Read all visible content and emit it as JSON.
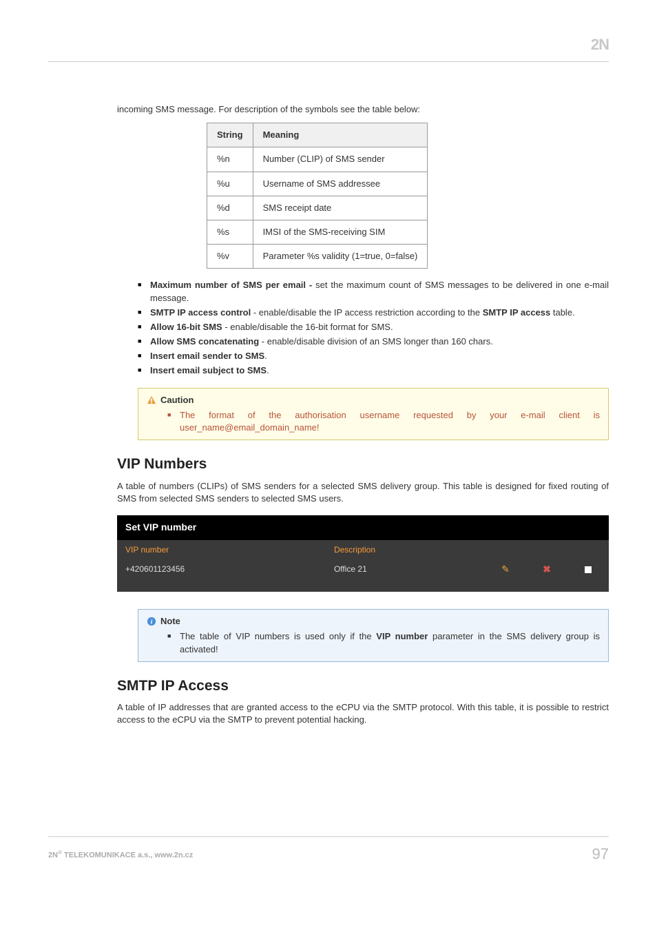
{
  "logo": "2N",
  "intro": "incoming SMS message. For description of the symbols see the table below:",
  "strings_header": {
    "col1": "String",
    "col2": "Meaning"
  },
  "strings": [
    {
      "s": "%n",
      "m": "Number (CLIP) of SMS sender"
    },
    {
      "s": "%u",
      "m": "Username of SMS addressee"
    },
    {
      "s": "%d",
      "m": "SMS receipt date"
    },
    {
      "s": "%s",
      "m": "IMSI of the SMS-receiving SIM"
    },
    {
      "s": "%v",
      "m": "Parameter %s validity (1=true, 0=false)"
    }
  ],
  "bullets": [
    {
      "b": "Maximum number of SMS per email - ",
      "t": "set the maximum count of SMS messages to be delivered in one e-mail message."
    },
    {
      "b": "SMTP IP access control",
      "t": " - enable/disable the IP access restriction according to the ",
      "b2": "SMTP IP access",
      "t2": " table."
    },
    {
      "b": "Allow 16-bit SMS",
      "t": " - enable/disable the 16-bit format for SMS."
    },
    {
      "b": "Allow SMS concatenating",
      "t": " - enable/disable division of an SMS longer than 160 chars."
    },
    {
      "b": "Insert email sender to SMS",
      "t": "."
    },
    {
      "b": "Insert email subject to SMS",
      "t": "."
    }
  ],
  "caution": {
    "title": "Caution",
    "text": "The format of the authorisation username requested by your e-mail client is user_name@email_domain_name!"
  },
  "vip": {
    "heading": "VIP Numbers",
    "para": "A table of numbers (CLIPs) of SMS senders for a selected SMS delivery group. This table is designed for fixed routing of SMS from selected SMS senders to selected SMS users.",
    "table_title": "Set VIP number",
    "col1": "VIP number",
    "col2": "Description",
    "row_num": "+420601123456",
    "row_desc": "Office 21"
  },
  "note": {
    "title": "Note",
    "text_pre": "The table of VIP numbers is used only if the ",
    "text_bold": "VIP number",
    "text_post": " parameter in the SMS delivery group is activated!"
  },
  "smtp": {
    "heading": "SMTP IP Access",
    "para": "A table of IP addresses that are granted access to the eCPU via the SMTP protocol. With this table, it is possible to restrict access to the eCPU via the SMTP to prevent potential hacking."
  },
  "footer": {
    "company": "2N",
    "reg": "®",
    "tail": " TELEKOMUNIKACE a.s., www.2n.cz",
    "page": "97"
  }
}
